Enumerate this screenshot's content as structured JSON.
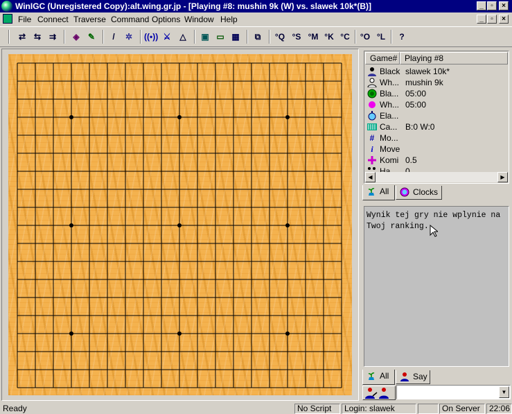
{
  "window": {
    "title": "WinIGC (Unregistered Copy):alt.wing.gr.jp - [Playing #8: mushin  9k (W) vs. slawek 10k*(B)]"
  },
  "menu": {
    "items": [
      "File",
      "Connect",
      "Traverse",
      "Command",
      "Options",
      "Window",
      "Help"
    ]
  },
  "toolbar": {
    "buttons": [
      "°Q",
      "°S",
      "°M",
      "°K",
      "°C",
      "°O",
      "°L",
      "?"
    ]
  },
  "board": {
    "size": 19,
    "star_points": [
      [
        3,
        3
      ],
      [
        3,
        9
      ],
      [
        3,
        15
      ],
      [
        9,
        3
      ],
      [
        9,
        9
      ],
      [
        9,
        15
      ],
      [
        15,
        3
      ],
      [
        15,
        9
      ],
      [
        15,
        15
      ]
    ]
  },
  "game_info": {
    "header": {
      "col1": "Game#",
      "col2": "Playing #8"
    },
    "rows": [
      {
        "icon": "black-player-icon",
        "label": "Black",
        "value": "slawek 10k*"
      },
      {
        "icon": "white-player-icon",
        "label": "Wh...",
        "value": "mushin  9k"
      },
      {
        "icon": "black-clock-icon",
        "label": "Bla...",
        "value": "05:00"
      },
      {
        "icon": "white-clock-icon",
        "label": "Wh...",
        "value": "05:00"
      },
      {
        "icon": "elapsed-icon",
        "label": "Ela...",
        "value": ""
      },
      {
        "icon": "captures-icon",
        "label": "Ca...",
        "value": "B:0 W:0"
      },
      {
        "icon": "moves-icon",
        "label": "Mo...",
        "value": ""
      },
      {
        "icon": "move-info-icon",
        "label": "Move",
        "value": ""
      },
      {
        "icon": "komi-icon",
        "label": "Komi",
        "value": "0.5"
      },
      {
        "icon": "handicap-icon",
        "label": "Ha...",
        "value": "0"
      }
    ],
    "tabs": [
      "All",
      "Clocks"
    ]
  },
  "chat": {
    "message": "Wynik tej gry nie wplynie na Twoj ranking.",
    "tabs": [
      "All",
      "Say"
    ]
  },
  "input": {
    "value": ""
  },
  "status": {
    "ready": "Ready",
    "script": "No Script",
    "login": "Login: slawek",
    "server": "On Server",
    "time": "22:06"
  },
  "colors": {
    "titlebar": "#000080",
    "board_wood": "#f4b24e",
    "chat_bg": "#c0c0c0"
  }
}
